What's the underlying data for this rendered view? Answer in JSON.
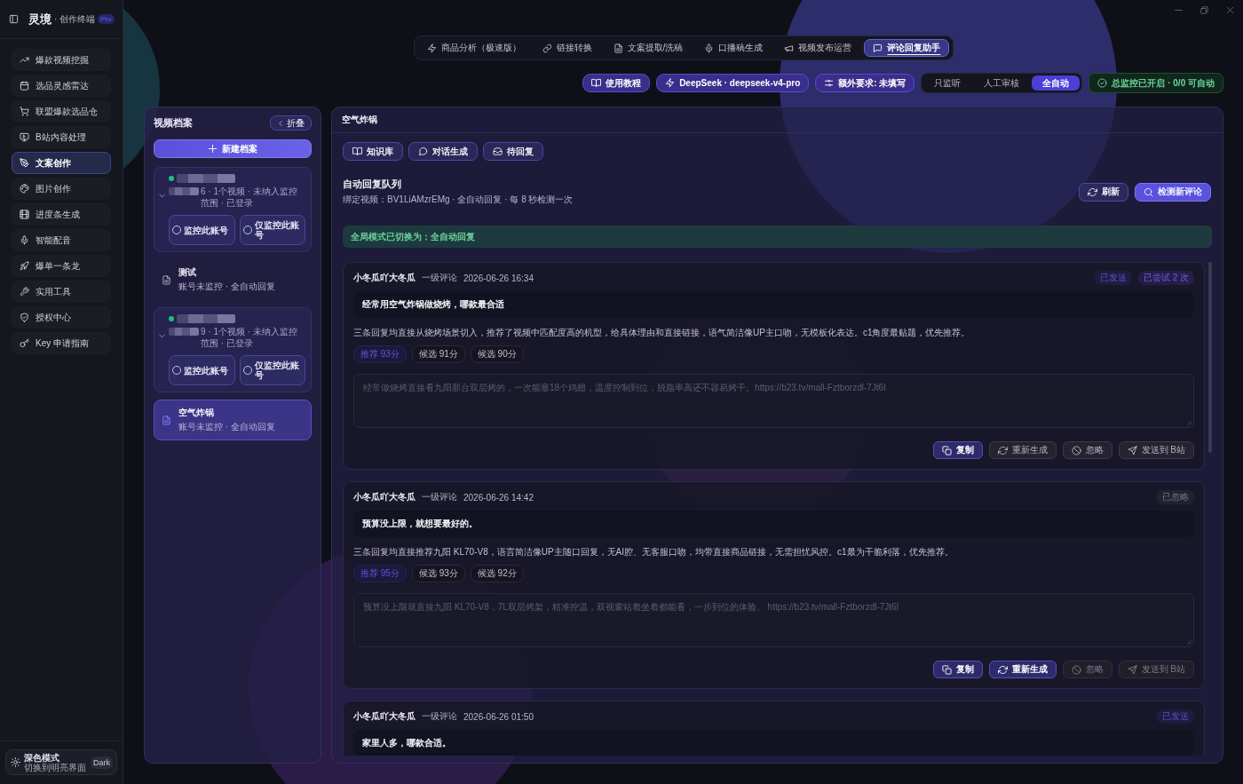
{
  "sidebar": {
    "brand": "灵境",
    "brand_suffix": "· 创作终端",
    "badge": "Pro",
    "items": [
      {
        "label": "爆款视频挖掘",
        "selected": false
      },
      {
        "label": "选品灵感雷达",
        "selected": false
      },
      {
        "label": "联盟爆款选品仓",
        "selected": false
      },
      {
        "label": "B站内容处理",
        "selected": false
      },
      {
        "label": "文案创作",
        "selected": true
      },
      {
        "label": "图片创作",
        "selected": false
      },
      {
        "label": "进度条生成",
        "selected": false
      },
      {
        "label": "智能配音",
        "selected": false
      },
      {
        "label": "爆单一条龙",
        "selected": false
      },
      {
        "label": "实用工具",
        "selected": false
      },
      {
        "label": "授权中心",
        "selected": false
      },
      {
        "label": "Key 申请指南",
        "selected": false
      }
    ],
    "theme_toggle": {
      "title": "深色模式",
      "subtitle": "切换到明亮界面",
      "badge": "Dark"
    }
  },
  "top_tabs": [
    {
      "label": "商品分析（极速版）",
      "selected": false
    },
    {
      "label": "链接转换",
      "selected": false
    },
    {
      "label": "文案提取/洗稿",
      "selected": false
    },
    {
      "label": "口播稿生成",
      "selected": false
    },
    {
      "label": "视频发布运营",
      "selected": false
    },
    {
      "label": "评论回复助手",
      "selected": true
    }
  ],
  "toolbar": {
    "tutorial": "使用教程",
    "model": "DeepSeek · deepseek-v4-pro",
    "extra": "额外要求: 未填写",
    "modes": [
      {
        "label": "只监听",
        "selected": false
      },
      {
        "label": "人工审核",
        "selected": false
      },
      {
        "label": "全自动",
        "selected": true
      }
    ],
    "status": "总监控已开启 · 0/0 可自动"
  },
  "archives": {
    "title": "视频档案",
    "collapse": "折叠",
    "new_button": "新建档案",
    "items": [
      {
        "kind": "account",
        "selected": false,
        "expanded": true,
        "online": true,
        "meta": "6 · 1个视频 · 未纳入监控范围 · 已登录",
        "options": [
          {
            "label": "监控此账号",
            "checked": false
          },
          {
            "label": "仅监控此账号",
            "checked": false
          }
        ]
      },
      {
        "kind": "document",
        "selected": false,
        "title": "测试",
        "subtitle": "账号未监控 · 全自动回复"
      },
      {
        "kind": "account",
        "selected": false,
        "expanded": true,
        "online": true,
        "meta": "9 · 1个视频 · 未纳入监控范围 · 已登录",
        "options": [
          {
            "label": "监控此账号",
            "checked": false
          },
          {
            "label": "仅监控此账号",
            "checked": false
          }
        ]
      },
      {
        "kind": "document",
        "selected": true,
        "title": "空气炸锅",
        "subtitle": "账号未监控 · 全自动回复"
      }
    ]
  },
  "workspace": {
    "title": "空气炸锅",
    "tools": [
      "知识库",
      "对话生成",
      "待回复"
    ],
    "queue": {
      "title": "自动回复队列",
      "subtitle": "绑定视频：BV1LiAMzrEMg · 全自动回复 · 每 8 秒检测一次",
      "refresh": "刷新",
      "detect": "检测新评论"
    },
    "notice": "全局模式已切换为：全自动回复",
    "comments": [
      {
        "author": "小冬瓜吖大冬瓜",
        "type_label": "一级评论",
        "time": "2026-06-26 16:34",
        "badges": [
          {
            "text": "已发送",
            "kind": "sent"
          },
          {
            "text": "已尝试 2 次",
            "kind": "attempts"
          }
        ],
        "quote": "经常用空气炸锅做烧烤，哪款最合适",
        "analysis": "三条回复均直接从烧烤场景切入，推荐了视频中匹配度高的机型，给具体理由和直接链接，语气简洁像UP主口吻，无模板化表达。c1角度最贴题，优先推荐。",
        "scores": [
          {
            "label": "推荐 93分",
            "selected": true
          },
          {
            "label": "候选 91分",
            "selected": false
          },
          {
            "label": "候选 90分",
            "selected": false
          }
        ],
        "reply": {
          "value": "经常做烧烤直接看九阳那台双层烤的，一次能塞18个鸡翅，温度控制到位，脱脂率高还不容易烤干。https://b23.tv/mall-Fztborzdl-7Jt6l",
          "disabled": true
        },
        "actions": [
          {
            "label": "复制",
            "kind": "primary",
            "disabled": false
          },
          {
            "label": "重新生成",
            "kind": "plain",
            "disabled": false
          },
          {
            "label": "忽略",
            "kind": "plain",
            "disabled": false
          },
          {
            "label": "发送到 B站",
            "kind": "plain",
            "disabled": false
          }
        ]
      },
      {
        "author": "小冬瓜吖大冬瓜",
        "type_label": "一级评论",
        "time": "2026-06-26 14:42",
        "badges": [
          {
            "text": "已忽略",
            "kind": "ignored"
          }
        ],
        "quote": "预算没上限，就想要最好的。",
        "analysis": "三条回复均直接推荐九阳 KL70-V8，语言简洁像UP主随口回复，无AI腔、无客服口吻，均带直接商品链接，无需担忧风控。c1最为干脆利落，优先推荐。",
        "scores": [
          {
            "label": "推荐 95分",
            "selected": true
          },
          {
            "label": "候选 93分",
            "selected": false
          },
          {
            "label": "候选 92分",
            "selected": false
          }
        ],
        "reply": {
          "value": "预算没上限就直接九阳 KL70-V8，7L双层烤架，精准控温，双视窗站着坐着都能看，一步到位的体验。 https://b23.tv/mall-Fztborzdl-7Jt6l",
          "disabled": true
        },
        "actions": [
          {
            "label": "复制",
            "kind": "primary",
            "disabled": false
          },
          {
            "label": "重新生成",
            "kind": "primary",
            "disabled": false
          },
          {
            "label": "忽略",
            "kind": "plain",
            "disabled": true
          },
          {
            "label": "发送到 B站",
            "kind": "plain",
            "disabled": true
          }
        ]
      },
      {
        "author": "小冬瓜吖大冬瓜",
        "type_label": "一级评论",
        "time": "2026-06-26 01:50",
        "badges": [
          {
            "text": "已发送",
            "kind": "sent"
          }
        ],
        "quote": "家里人多，哪款合适。"
      }
    ]
  }
}
